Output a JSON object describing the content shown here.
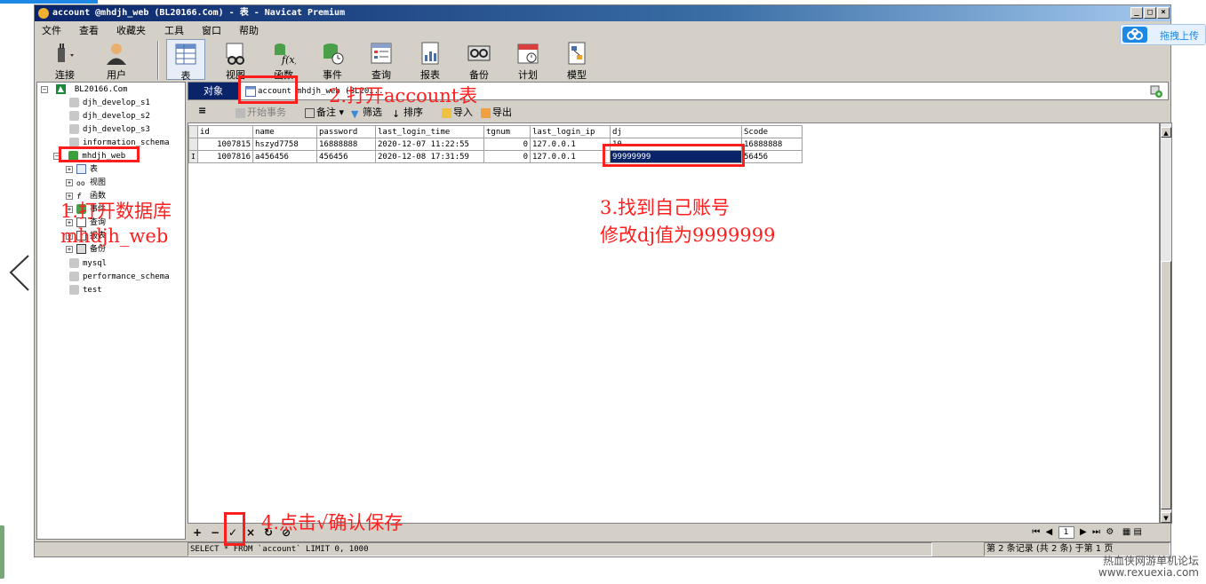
{
  "window": {
    "title": "account @mhdjh_web (BL20166.Com) - 表 - Navicat Premium",
    "minimize": "_",
    "maximize": "□",
    "close": "×"
  },
  "menu": [
    "文件",
    "查看",
    "收藏夹",
    "工具",
    "窗口",
    "帮助"
  ],
  "toolbar": [
    {
      "label": "连接",
      "icon": "plug-icon"
    },
    {
      "label": "用户",
      "icon": "user-icon"
    },
    {
      "label": "表",
      "icon": "table-icon"
    },
    {
      "label": "视图",
      "icon": "view-icon"
    },
    {
      "label": "函数",
      "icon": "function-icon"
    },
    {
      "label": "事件",
      "icon": "event-icon"
    },
    {
      "label": "查询",
      "icon": "query-icon"
    },
    {
      "label": "报表",
      "icon": "report-icon"
    },
    {
      "label": "备份",
      "icon": "backup-icon"
    },
    {
      "label": "计划",
      "icon": "schedule-icon"
    },
    {
      "label": "模型",
      "icon": "model-icon"
    }
  ],
  "tree": {
    "server": "BL20166.Com",
    "databases": [
      "djh_develop_s1",
      "djh_develop_s2",
      "djh_develop_s3",
      "information_schema",
      "mhdjh_web"
    ],
    "children": [
      "表",
      "视图",
      "函数",
      "事件",
      "查询",
      "报表",
      "备份"
    ],
    "other_dbs": [
      "mysql",
      "performance_schema",
      "test"
    ]
  },
  "tabs": {
    "objects": "对象",
    "account": "account",
    "rest": "mhdjh_web (BL20I..."
  },
  "subtoolbar": {
    "begin_tx": "开始事务",
    "memo": "备注",
    "filter": "筛选",
    "sort": "排序",
    "import": "导入",
    "export": "导出"
  },
  "grid": {
    "columns": [
      "id",
      "name",
      "password",
      "last_login_time",
      "tgnum",
      "last_login_ip",
      "dj",
      "Scode"
    ],
    "rows": [
      [
        "1007815",
        "hszyd7758",
        "16888888",
        "2020-12-07 11:22:55",
        "0",
        "127.0.0.1",
        "10",
        "16888888"
      ],
      [
        "1007816",
        "a456456",
        "456456",
        "2020-12-08 17:31:59",
        "0",
        "127.0.0.1",
        "99999999",
        "56456"
      ]
    ]
  },
  "nav": {
    "add": "+",
    "delete": "−",
    "apply": "✓",
    "cancel": "×",
    "refresh": "↻",
    "stop": "⊘",
    "page": "1"
  },
  "status": {
    "sql": "SELECT * FROM `account` LIMIT 0, 1000",
    "record": "第 2 条记录 (共 2 条) 于第 1 页"
  },
  "upload": {
    "label": "拖拽上传"
  },
  "annotations": {
    "step1_line1": "1.打开数据库",
    "step1_line2": "mhdjh_web",
    "step2": "2.打开account表",
    "step3_line1": "3.找到自己账号",
    "step3_line2": "修改dj值为9999999",
    "step4": "4.点击√确认保存"
  },
  "watermark": {
    "line1": "热血侠网游单机论坛",
    "line2": "www.rexuexia.com"
  }
}
